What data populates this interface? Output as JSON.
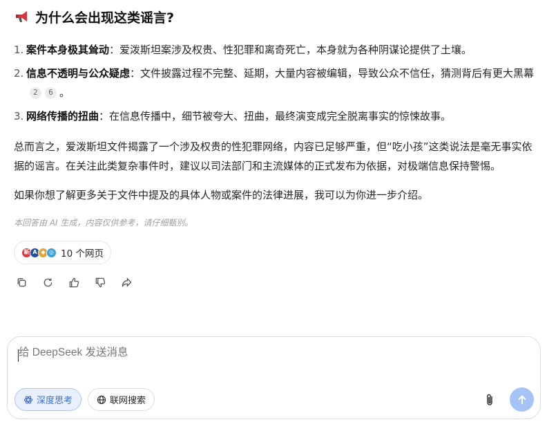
{
  "answer": {
    "heading": "为什么会出现这类谣言?",
    "points": [
      {
        "num": "1.",
        "title": "案件本身极其耸动",
        "text": "：爱泼斯坦案涉及权贵、性犯罪和离奇死亡，本身就为各种阴谋论提供了土壤。",
        "citations": []
      },
      {
        "num": "2.",
        "title": "信息不透明与公众疑虑",
        "text": "：文件披露过程不完整、延期，大量内容被编辑，导致公众不信任，猜测背后有更大黑幕",
        "citations": [
          "2",
          "6"
        ],
        "tail": "。"
      },
      {
        "num": "3.",
        "title": "网络传播的扭曲",
        "text": "：在信息传播中，细节被夸大、扭曲，最终演变成完全脱离事实的惊悚故事。",
        "citations": []
      }
    ],
    "summary": "总而言之，爱泼斯坦文件揭露了一个涉及权贵的性犯罪网络，内容已足够严重，但“吃小孩”这类说法是毫无事实依据的谣言。在关注此类复杂事件时，建议以司法部门和主流媒体的正式发布为依据，对极端信息保持警惕。",
    "followup": "如果你想了解更多关于文件中提及的具体人物或案件的法律进展，我可以为你进一步介绍。",
    "disclaimer": "本回答由 AI 生成，内容仅供参考，请仔细甄别。",
    "sources": {
      "label": "10 个网页",
      "favicons": [
        {
          "icon": "news-site-icon",
          "color": "#d9363e"
        },
        {
          "icon": "media-site-icon",
          "color": "#1f4fa3"
        },
        {
          "icon": "portal-site-icon",
          "color": "#e8a23a"
        },
        {
          "icon": "globe-site-icon",
          "color": "#3aa0d8"
        }
      ]
    },
    "actions": [
      "copy-icon",
      "regenerate-icon",
      "thumbs-up-icon",
      "thumbs-down-icon",
      "share-icon"
    ]
  },
  "composer": {
    "placeholder": "给 DeepSeek 发送消息",
    "deep_think_label": "深度思考",
    "web_search_label": "联网搜索",
    "accent": "#3b6fd6",
    "send_color": "#a6c3f5"
  }
}
